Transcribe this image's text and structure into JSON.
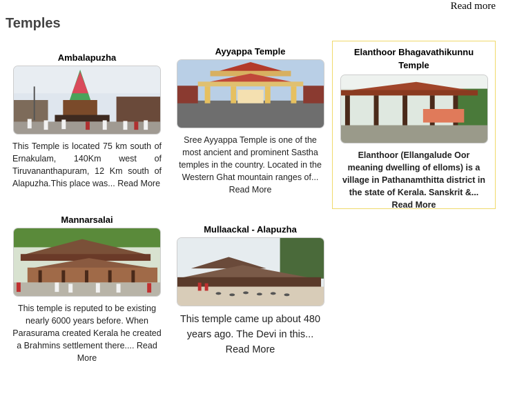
{
  "header": {
    "read_more": "Read more"
  },
  "page": {
    "title": "Temples"
  },
  "read_more_label": "Read More",
  "cards": [
    {
      "title": "Ambalapuzha",
      "image_alt": "Ambalapuzha temple festival chariot",
      "text": "This Temple is located 75 km south of Ernakulam, 140Km west of Tiruvananthapuram, 12 Km south of Alapuzha.This place was..."
    },
    {
      "title": "Ayyappa Temple",
      "image_alt": "Ayyappa temple gateway",
      "text": "Sree Ayyappa Temple is one of the most ancient and prominent Sastha temples in the country. Located in the Western Ghat mountain ranges of..."
    },
    {
      "title": "Elanthoor Bhagavathikunnu Temple",
      "image_alt": "Elanthoor temple pavilion",
      "text": "Elanthoor (Ellangalude Oor meaning dwelling of elloms) is a village in Pathanamthitta district in the state of Kerala. Sanskrit &..."
    },
    {
      "title": "Mannarsalai",
      "image_alt": "Mannarsalai temple",
      "text": "This  temple is reputed to be existing nearly 6000 years before. When Parasurama created Kerala he created a Brahmins  settlement  there...."
    },
    {
      "title": "Mullaackal - Alapuzha",
      "image_alt": "Mullaackal temple",
      "text": "This  temple came up about 480 years ago. The Devi  in this..."
    }
  ]
}
